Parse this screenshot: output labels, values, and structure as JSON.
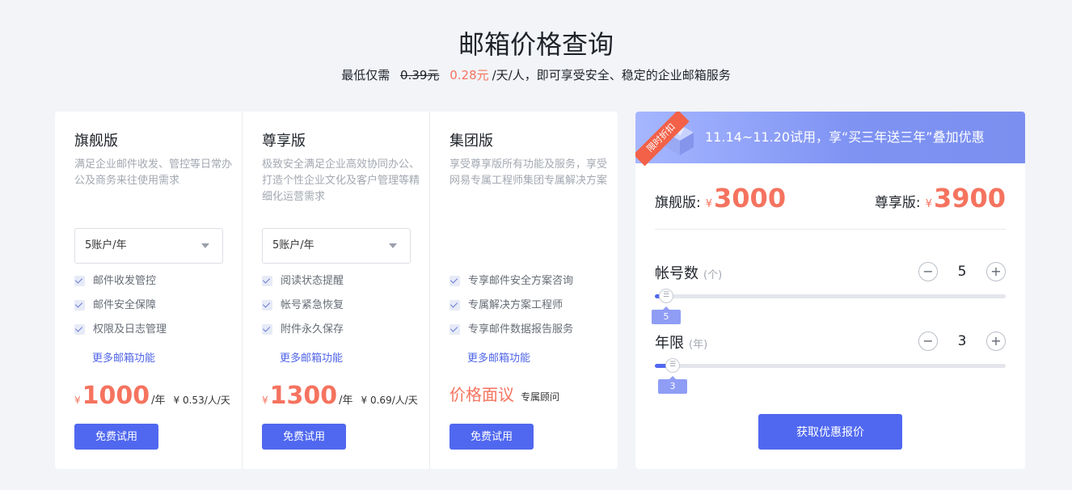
{
  "header": {
    "title": "邮箱价格查询",
    "subtitle_prefix": "最低仅需",
    "old_price": "0.39元",
    "new_price": "0.28元",
    "subtitle_suffix": "/天/人，即可享受安全、稳定的企业邮箱服务"
  },
  "plans": [
    {
      "name": "旗舰版",
      "desc": "满足企业邮件收发、管控等日常办公及商务来往使用需求",
      "select_value": "5账户/年",
      "features": [
        "邮件收发管控",
        "邮件安全保障",
        "权限及日志管理"
      ],
      "more_link": "更多邮箱功能",
      "currency": "¥",
      "price": "1000",
      "per_year": "/年",
      "per_day": "¥ 0.53/人/天",
      "trial_label": "免费试用"
    },
    {
      "name": "尊享版",
      "desc": "极致安全满足企业高效协同办公、打造个性企业文化及客户管理等精细化运营需求",
      "select_value": "5账户/年",
      "features": [
        "阅读状态提醒",
        "帐号紧急恢复",
        "附件永久保存"
      ],
      "more_link": "更多邮箱功能",
      "currency": "¥",
      "price": "1300",
      "per_year": "/年",
      "per_day": "¥ 0.69/人/天",
      "trial_label": "免费试用"
    },
    {
      "name": "集团版",
      "desc": "享受尊享版所有功能及服务，享受网易专属工程师集团专属解决方案",
      "features": [
        "专享邮件安全方案咨询",
        "专属解决方案工程师",
        "专享邮件数据报告服务"
      ],
      "more_link": "更多邮箱功能",
      "price_text": "价格面议",
      "consultant": "专属顾问",
      "trial_label": "免费试用"
    }
  ],
  "calculator": {
    "ribbon": "限时折扣",
    "promo": "11.14~11.20试用，享“买三年送三年”叠加优惠",
    "flagship_label": "旗舰版:",
    "flagship_currency": "¥",
    "flagship_price": "3000",
    "premium_label": "尊享版:",
    "premium_currency": "¥",
    "premium_price": "3900",
    "accounts": {
      "label": "帐号数",
      "unit": "(个)",
      "value": "5",
      "minus": "−",
      "plus": "+",
      "tip": "5",
      "fraction": 0.02
    },
    "years": {
      "label": "年限",
      "unit": "(年)",
      "value": "3",
      "minus": "−",
      "plus": "+",
      "tip": "3",
      "fraction": 0.04
    },
    "quote_button": "获取优惠报价"
  },
  "colors": {
    "accent": "#5068f0",
    "price": "#f5735f"
  }
}
